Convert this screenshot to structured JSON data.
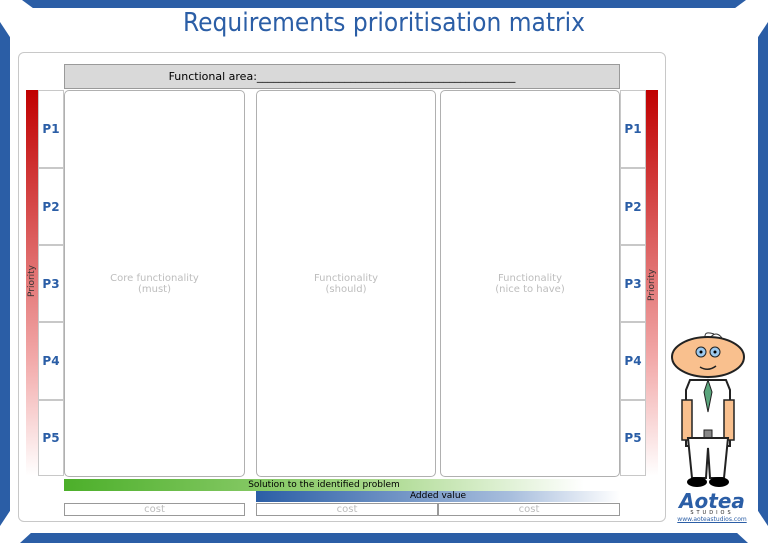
{
  "title": "Requirements prioritisation matrix",
  "header": {
    "label": "Functional area:_______________________________________________"
  },
  "priority_label": "Priority",
  "priorities": [
    "P1",
    "P2",
    "P3",
    "P4",
    "P5"
  ],
  "columns": [
    {
      "label": "Core functionality\n(must)"
    },
    {
      "label": "Functionality\n(should)"
    },
    {
      "label": "Functionality\n(nice to have)"
    }
  ],
  "bars": {
    "solution": "Solution to the identified problem",
    "added_value": "Added value"
  },
  "cost_label": "cost",
  "logo": {
    "name": "Aotea",
    "sub": "STUDIOS",
    "url": "www.aoteastudios.com"
  },
  "colors": {
    "brand": "#2b5ea6",
    "priority": "#c00000",
    "solution": "#4caf2a"
  }
}
